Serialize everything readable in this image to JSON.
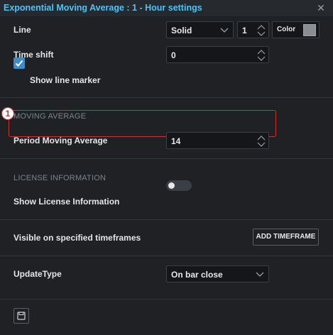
{
  "window": {
    "title": "Exponential Moving Average : 1 - Hour settings",
    "close_glyph": "✕"
  },
  "line": {
    "label": "Line",
    "style_value": "Solid",
    "width_value": "1",
    "color_label": "Color",
    "color_swatch": "#8a8d91"
  },
  "time_shift": {
    "label": "Time shift",
    "value": "0"
  },
  "show_line_marker": {
    "label": "Show line marker",
    "checked": true
  },
  "moving_average": {
    "section_title": "MOVING AVERAGE",
    "period_label": "Period Moving Average",
    "period_value": "14",
    "annotation_number": "1"
  },
  "license": {
    "section_title": "LICENSE INFORMATION",
    "show_label": "Show License Information",
    "show_enabled": false
  },
  "timeframes": {
    "label": "Visible on specified timeframes",
    "add_button": "ADD TIMEFRAME"
  },
  "update_type": {
    "label": "UpdateType",
    "value": "On bar close"
  },
  "footer": {
    "save_icon": "floppy-disk-icon"
  },
  "colors": {
    "accent_title": "#4fc3f7",
    "checkbox": "#3b8ec9",
    "highlight_border": "#d32f2f"
  }
}
